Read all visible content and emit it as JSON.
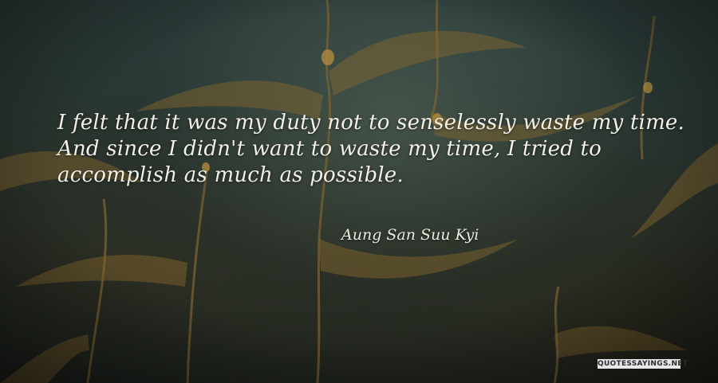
{
  "quote": {
    "text": "I felt that it was my duty not to senselessly waste my time. And since I didn't want to waste my time, I tried to accomplish as much as possible.",
    "author": "Aung San Suu Kyi"
  },
  "watermark": {
    "text": "QUOTESSAYINGS.NET"
  },
  "colors": {
    "text": "#f2efe6",
    "background_dark": "#1d2a2c",
    "kelp": "#9a7a3a"
  }
}
